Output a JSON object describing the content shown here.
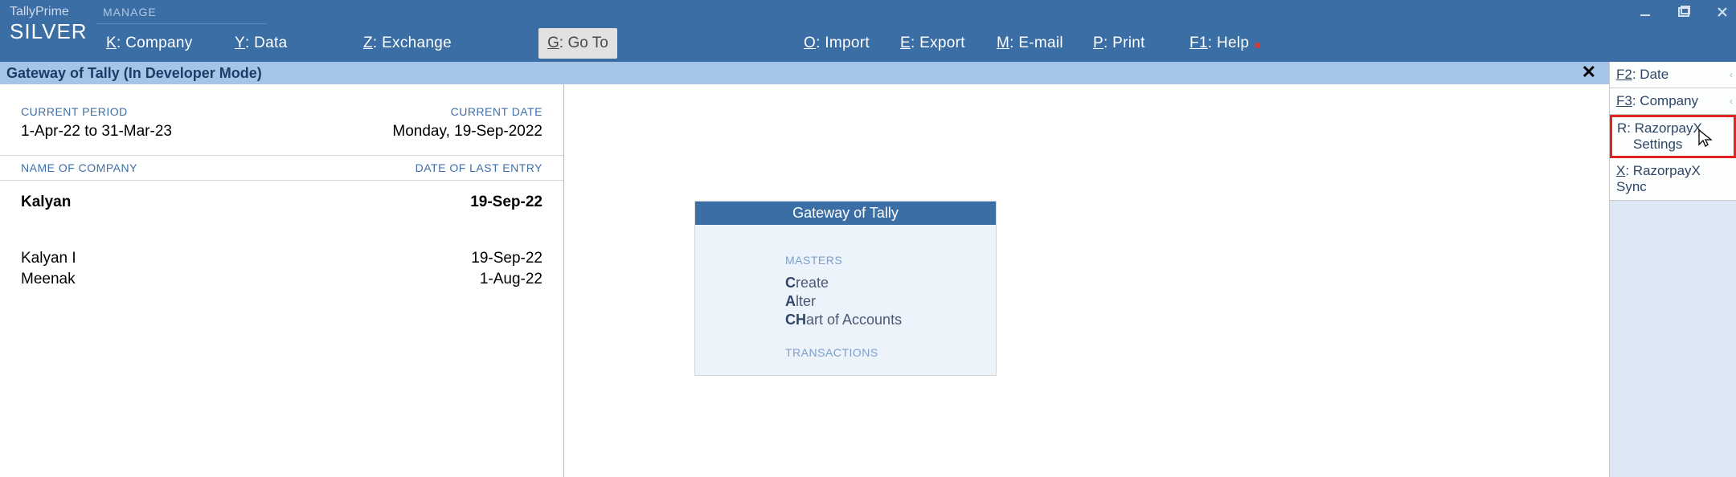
{
  "brand": {
    "line1": "TallyPrime",
    "line2": "SILVER"
  },
  "topmenu": {
    "manage_label": "MANAGE",
    "company": {
      "key": "K",
      "label": "Company"
    },
    "data": {
      "key": "Y",
      "label": "Data"
    },
    "exchange": {
      "key": "Z",
      "label": "Exchange"
    },
    "goto": {
      "key": "G",
      "label": "Go To"
    },
    "import": {
      "key": "O",
      "label": "Import"
    },
    "export": {
      "key": "E",
      "label": "Export"
    },
    "email": {
      "key": "M",
      "label": "E-mail"
    },
    "print": {
      "key": "P",
      "label": "Print"
    },
    "help": {
      "key": "F1",
      "label": "Help"
    }
  },
  "subheader": {
    "title": "Gateway of Tally (In Developer Mode)"
  },
  "period": {
    "current_period_label": "CURRENT PERIOD",
    "current_period_value": "1-Apr-22 to 31-Mar-23",
    "current_date_label": "CURRENT DATE",
    "current_date_value": "Monday, 19-Sep-2022"
  },
  "company_table": {
    "name_header": "NAME OF COMPANY",
    "date_header": "DATE OF LAST ENTRY",
    "rows": [
      {
        "name": "Kalyan",
        "date": "19-Sep-22",
        "primary": true
      },
      {
        "name": "Kalyan I",
        "date": "19-Sep-22",
        "primary": false
      },
      {
        "name": "Meenak",
        "date": "1-Aug-22",
        "primary": false
      }
    ]
  },
  "gateway": {
    "title": "Gateway of Tally",
    "masters_label": "MASTERS",
    "items_masters": [
      {
        "key": "C",
        "rest": "reate"
      },
      {
        "key": "A",
        "rest": "lter"
      },
      {
        "key": "CH",
        "rest": "art of Accounts"
      }
    ],
    "transactions_label": "TRANSACTIONS"
  },
  "right_fn": {
    "date": {
      "key": "F2",
      "label": "Date"
    },
    "company": {
      "key": "F3",
      "label": "Company"
    },
    "rzp": {
      "key": "R",
      "label1": "RazorpayX",
      "label2": "Settings"
    },
    "rzp_sync": {
      "key": "X",
      "label": "RazorpayX Sync"
    }
  }
}
